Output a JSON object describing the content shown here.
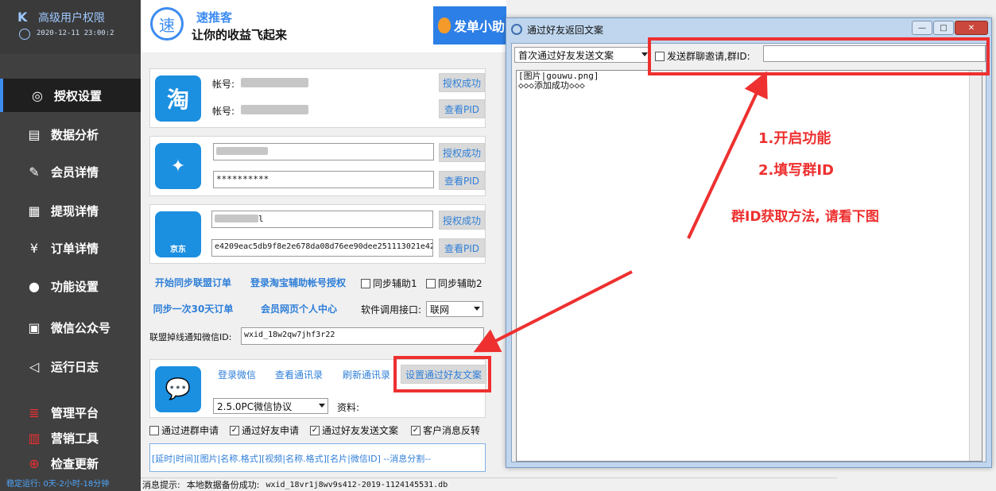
{
  "sidebar": {
    "logo": "K",
    "title": "高级用户权限",
    "time": "2020-12-11 23:00:2",
    "items": [
      {
        "label": "授权设置",
        "icon": "globe-icon"
      },
      {
        "label": "数据分析",
        "icon": "chart-icon"
      },
      {
        "label": "会员详情",
        "icon": "edit-icon"
      },
      {
        "label": "提现详情",
        "icon": "search-doc-icon"
      },
      {
        "label": "订单详情",
        "icon": "yen-doc-icon"
      },
      {
        "label": "功能设置",
        "icon": "wechat-icon"
      },
      {
        "label": "微信公众号",
        "icon": "mp-icon"
      },
      {
        "label": "运行日志",
        "icon": "speaker-icon"
      },
      {
        "label": "管理平台",
        "icon": "layers-icon"
      },
      {
        "label": "营销工具",
        "icon": "bar-chart-icon"
      },
      {
        "label": "检查更新",
        "icon": "update-icon"
      }
    ],
    "status": "稳定运行: 0天-2小时-18分钟"
  },
  "header": {
    "logo_char": "速",
    "brand_name": "速推客",
    "slogan": "让你的收益飞起来",
    "promo_button": "发单小助"
  },
  "taobao": {
    "icon_char": "淘",
    "account_label_1": "帐号:",
    "account_label_2": "帐号:",
    "auth_button": "授权成功",
    "pid_button": "查看PID"
  },
  "pdd": {
    "password": "**********",
    "auth_button": "授权成功",
    "pid_button": "查看PID"
  },
  "jd": {
    "icon_label": "京东",
    "username_tail": "l",
    "token": "e4209eac5db9f8e2e678da08d76ee90dee251113021e42",
    "auth_button": "授权成功",
    "pid_button": "查看PID"
  },
  "actions": {
    "sync_orders": "开始同步联盟订单",
    "login_taobao_helper": "登录淘宝辅助帐号授权",
    "sync_helper_1": "同步辅助1",
    "sync_helper_2": "同步辅助2",
    "sync_30days": "同步一次30天订单",
    "member_center": "会员网页个人中心",
    "api_label": "软件调用接口:",
    "api_value": "联网",
    "notify_label": "联盟掉线通知微信ID:",
    "notify_value": "wxid_18w2qw7jhf3r22"
  },
  "wechat": {
    "login": "登录微信",
    "view_contacts": "查看通讯录",
    "refresh_contacts": "刷新通讯录",
    "set_friend_text": "设置通过好友文案",
    "protocol": "2.5.0PC微信协议",
    "profile_label": "资料:",
    "chk_group": "通过进群申请",
    "chk_friend": "通过好友申请",
    "chk_send_text": "通过好友发送文案",
    "chk_reverse": "客户消息反转",
    "tags": "[延时|时间][图片|名称.格式][视频|名称.格式][名片|微信ID] --消息分割--"
  },
  "status_bar": {
    "label": "消息提示:",
    "message": "本地数据备份成功:",
    "file": "wxid_18vr1j8wv9s412-2019-1124145531.db"
  },
  "dialog": {
    "title": "通过好友返回文案",
    "mode_select": "首次通过好友发送文案",
    "group_invite_label": "发送群聊邀请,群ID:",
    "group_id_value": "",
    "text_line_1": "[图片|gouwu.png]",
    "text_line_2": "◇◇◇添加成功◇◇◇"
  },
  "annotations": {
    "step1": "1.开启功能",
    "step2": "2.填写群ID",
    "hint": "群ID获取方法, 请看下图"
  },
  "colors": {
    "accent": "#3d8cf0",
    "annotation_red": "#ee3030",
    "sidebar_bg": "#404040"
  }
}
